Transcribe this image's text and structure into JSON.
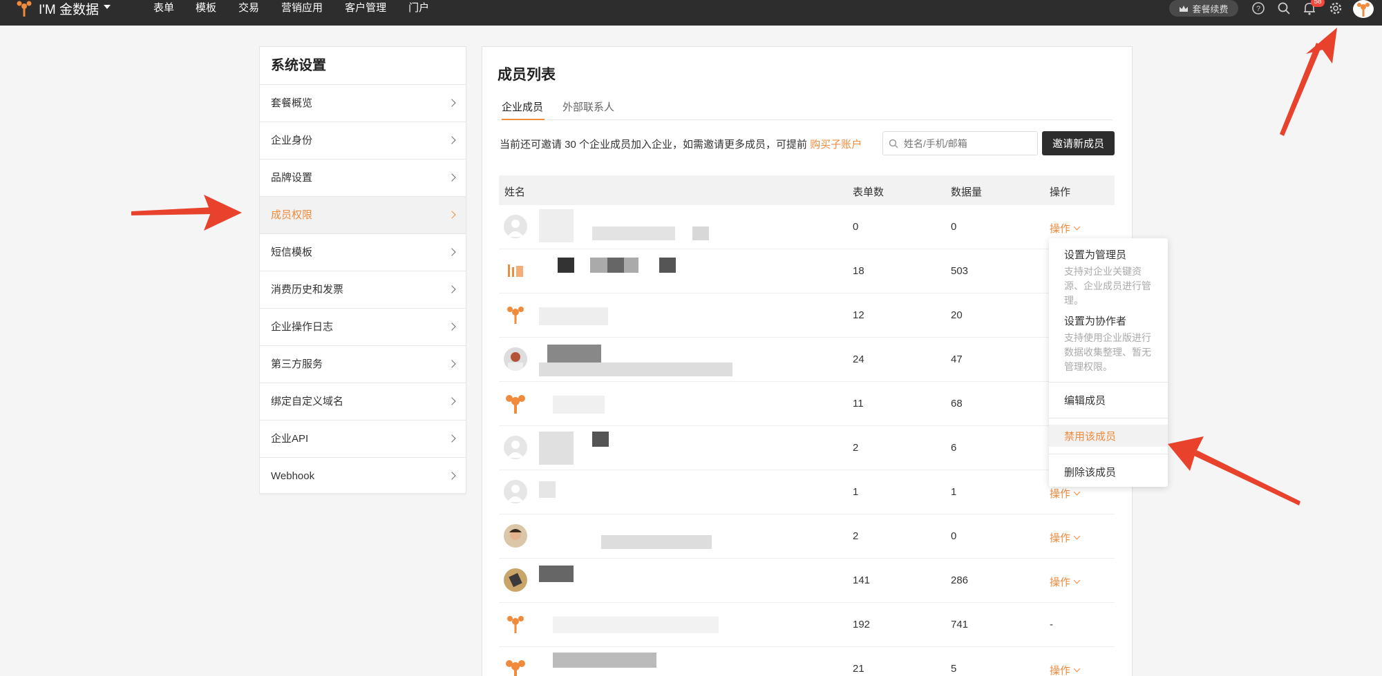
{
  "app": {
    "logo_text": "I'M 金数据",
    "nav": [
      "表单",
      "模板",
      "交易",
      "营销应用",
      "客户管理",
      "门户"
    ],
    "renew_label": "套餐续费",
    "notification_count": "58",
    "icons": [
      "help-icon",
      "search-icon",
      "bell-icon",
      "gear-icon",
      "user-avatar"
    ]
  },
  "sidebar": {
    "title": "系统设置",
    "items": [
      {
        "label": "套餐概览"
      },
      {
        "label": "企业身份"
      },
      {
        "label": "品牌设置"
      },
      {
        "label": "成员权限",
        "active": true
      },
      {
        "label": "短信模板"
      },
      {
        "label": "消费历史和发票"
      },
      {
        "label": "企业操作日志"
      },
      {
        "label": "第三方服务"
      },
      {
        "label": "绑定自定义域名"
      },
      {
        "label": "企业API"
      },
      {
        "label": "Webhook"
      }
    ]
  },
  "main": {
    "title": "成员列表",
    "tabs": [
      {
        "label": "企业成员",
        "active": true
      },
      {
        "label": "外部联系人"
      }
    ],
    "invite_text": "当前还可邀请 30 个企业成员加入企业，如需邀请更多成员，可提前",
    "invite_link": "购买子账户",
    "search_placeholder": "姓名/手机/邮箱",
    "invite_button": "邀请新成员",
    "columns": {
      "name": "姓名",
      "forms": "表单数",
      "data": "数据量",
      "ops": "操作"
    },
    "rows": [
      {
        "forms": "0",
        "data": "0",
        "op": "操作"
      },
      {
        "forms": "18",
        "data": "503",
        "op": ""
      },
      {
        "forms": "12",
        "data": "20",
        "op": ""
      },
      {
        "forms": "24",
        "data": "47",
        "op": ""
      },
      {
        "forms": "11",
        "data": "68",
        "op": ""
      },
      {
        "forms": "2",
        "data": "6",
        "op": ""
      },
      {
        "forms": "1",
        "data": "1",
        "op": "操作"
      },
      {
        "forms": "2",
        "data": "0",
        "op": "操作"
      },
      {
        "forms": "141",
        "data": "286",
        "op": "操作"
      },
      {
        "forms": "192",
        "data": "741",
        "op": "-"
      },
      {
        "forms": "21",
        "data": "5",
        "op": "操作"
      }
    ]
  },
  "dropdown": {
    "set_admin": "设置为管理员",
    "set_admin_desc": "支持对企业关键资源、企业成员进行管理。",
    "set_collab": "设置为协作者",
    "set_collab_desc": "支持使用企业版进行数据收集整理、暂无管理权限。",
    "edit": "编辑成员",
    "disable": "禁用该成员",
    "delete": "删除该成员"
  },
  "colors": {
    "accent": "#f08a3c",
    "topbar": "#2d2d2d",
    "annotation": "#e8412c"
  }
}
